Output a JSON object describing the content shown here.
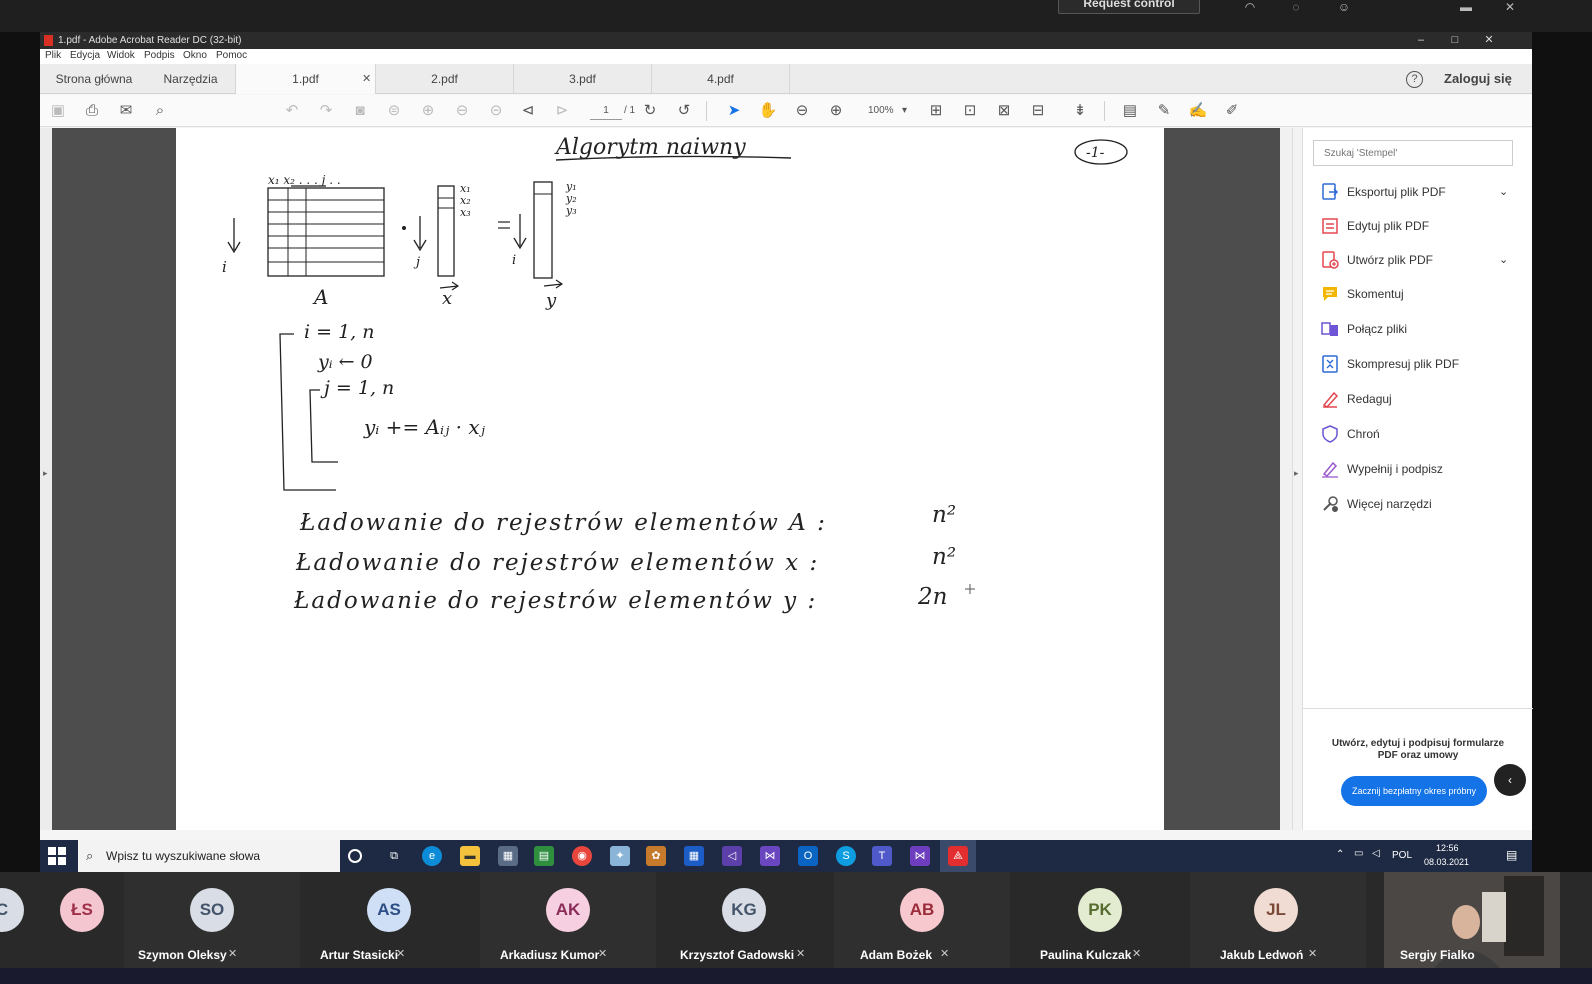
{
  "teams": {
    "request_control": "Request control"
  },
  "window": {
    "title": "1.pdf - Adobe Acrobat Reader DC (32-bit)",
    "minimize": "–",
    "maximize": "□",
    "close": "✕"
  },
  "menu": [
    "Plik",
    "Edycja",
    "Widok",
    "Podpis",
    "Okno",
    "Pomoc"
  ],
  "tabs": {
    "home": "Strona główna",
    "tools": "Narzędzia",
    "docs": [
      "1.pdf",
      "2.pdf",
      "3.pdf",
      "4.pdf"
    ],
    "close": "✕"
  },
  "account": {
    "help": "?",
    "login": "Zaloguj się"
  },
  "toolbar": {
    "page_current": "1",
    "page_total": "/ 1",
    "zoom": "100%"
  },
  "document": {
    "title": "Algorytm naiwny",
    "page_mark": "-1-",
    "loop_i": "i = 1, n",
    "init": "yᵢ ← 0",
    "loop_j": "j = 1, n",
    "accum": "yᵢ += Aᵢⱼ · xⱼ",
    "matrix_label": "A",
    "vec_x": "x",
    "vec_y": "y",
    "idx_i": "i",
    "idx_j": "j",
    "x_entries": [
      "x₁",
      "x₂",
      "x₃"
    ],
    "y_entries": [
      "y₁",
      "y₂",
      "y₃"
    ],
    "col_header": "x₁ x₂ . . . j . .",
    "line1_text": "Ładowanie do rejestrów elementów A :",
    "line1_val": "n²",
    "line2_text": "Ładowanie do rejestrów elementów x :",
    "line2_val": "n²",
    "line3_text": "Ładowanie do rejestrów elementów y :",
    "line3_val": "2n"
  },
  "right_pane": {
    "search_placeholder": "Szukaj 'Stempel'",
    "tools": [
      {
        "label": "Eksportuj plik PDF",
        "icon": "export-pdf-icon",
        "color": "#2d6ad5"
      },
      {
        "label": "Edytuj plik PDF",
        "icon": "edit-pdf-icon",
        "color": "#e34850"
      },
      {
        "label": "Utwórz plik PDF",
        "icon": "create-pdf-icon",
        "color": "#e34850"
      },
      {
        "label": "Skomentuj",
        "icon": "comment-icon",
        "color": "#f2b600"
      },
      {
        "label": "Połącz pliki",
        "icon": "combine-files-icon",
        "color": "#6d55d6"
      },
      {
        "label": "Skompresuj plik PDF",
        "icon": "compress-pdf-icon",
        "color": "#2d6ad5"
      },
      {
        "label": "Redaguj",
        "icon": "redact-icon",
        "color": "#e34850"
      },
      {
        "label": "Chroń",
        "icon": "protect-icon",
        "color": "#6d55d6"
      },
      {
        "label": "Wypełnij i podpisz",
        "icon": "fill-sign-icon",
        "color": "#9b59d0"
      },
      {
        "label": "Więcej narzędzi",
        "icon": "more-tools-icon",
        "color": "#555555"
      }
    ],
    "promo": "Utwórz, edytuj i podpisuj formularze PDF oraz umowy",
    "trial_button": "Zacznij bezpłatny okres próbny"
  },
  "taskbar": {
    "search_placeholder": "Wpisz tu wyszukiwane słowa",
    "language": "POL",
    "time": "12:56",
    "date": "08.03.2021"
  },
  "participants": [
    {
      "initials": "ŁS",
      "name": "",
      "color": "#f4c6d0",
      "text": "#a0304a"
    },
    {
      "initials": "SO",
      "name": "Szymon Oleksy",
      "color": "#d8dde6",
      "text": "#44546a"
    },
    {
      "initials": "AS",
      "name": "Artur Stasicki",
      "color": "#cfdff5",
      "text": "#2d4f86"
    },
    {
      "initials": "AK",
      "name": "Arkadiusz Kumor",
      "color": "#f6cfe0",
      "text": "#8a2c58"
    },
    {
      "initials": "KG",
      "name": "Krzysztof Gadowski",
      "color": "#d8dde6",
      "text": "#44546a"
    },
    {
      "initials": "AB",
      "name": "Adam Bożek",
      "color": "#f7c9cf",
      "text": "#9b2c3a"
    },
    {
      "initials": "PK",
      "name": "Paulina Kulczak",
      "color": "#e3ecd0",
      "text": "#556b2f"
    },
    {
      "initials": "JL",
      "name": "Jakub Ledwoń",
      "color": "#f1dcd3",
      "text": "#7a4a38"
    }
  ],
  "presenter": {
    "name": "Sergiy Fialko"
  }
}
